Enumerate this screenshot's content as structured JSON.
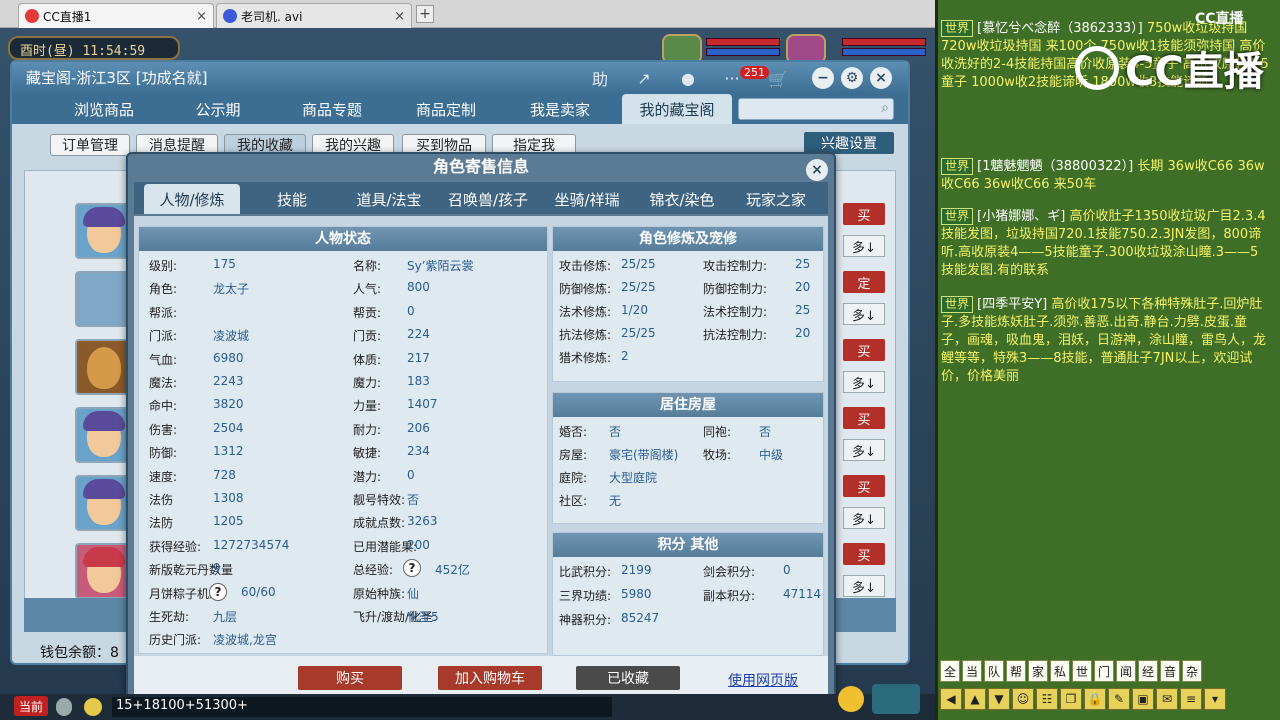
{
  "browser": {
    "tabs": [
      {
        "label": "CC直播1",
        "active": true
      },
      {
        "label": "老司机. avi",
        "active": false
      }
    ],
    "new_tab": "+",
    "close_glyph": "×"
  },
  "game": {
    "clock": "酉时(昼) 11:54:59",
    "bottom": {
      "current_tab": "当前",
      "input_text": "15+18100+51300+"
    }
  },
  "window": {
    "title": "藏宝阁-浙江3区 [功成名就]",
    "cart_badge": "251",
    "tool_labels": {
      "help": "助",
      "share": "↗",
      "record": "●",
      "chat": "···",
      "cart": "🛒",
      "min": "−",
      "settings": "⚙",
      "close": "×"
    },
    "nav": [
      "浏览商品",
      "公示期",
      "商品专题",
      "商品定制",
      "我是卖家",
      "我的藏宝阁"
    ],
    "nav_active": 5,
    "subtabs": [
      "订单管理",
      "消息提醒",
      "我的收藏",
      "我的兴趣",
      "买到物品",
      "指定我"
    ],
    "subtab_active": 2,
    "interest_button": "兴趣设置",
    "list_buttons": {
      "buy": "买",
      "more": "多↓",
      "fixed": "定"
    },
    "wallet_label": "钱包余额：8"
  },
  "modal": {
    "title": "角色寄售信息",
    "close": "×",
    "tabs": [
      "人物/修炼",
      "技能",
      "道具/法宝",
      "召唤兽/孩子",
      "坐骑/祥瑞",
      "锦衣/染色",
      "玩家之家"
    ],
    "tab_active": 0,
    "status": {
      "title": "人物状态",
      "left": [
        {
          "k": "级别:",
          "v": "175"
        },
        {
          "k": "角色:",
          "v": "龙太子"
        },
        {
          "k": "帮派:",
          "v": ""
        },
        {
          "k": "门派:",
          "v": "凌波城"
        },
        {
          "k": "气血:",
          "v": "6980"
        },
        {
          "k": "魔法:",
          "v": "2243"
        },
        {
          "k": "命中:",
          "v": "3820"
        },
        {
          "k": "伤害:",
          "v": "2504"
        },
        {
          "k": "防御:",
          "v": "1312"
        },
        {
          "k": "速度:",
          "v": "728"
        },
        {
          "k": "法伤",
          "v": "1308"
        },
        {
          "k": "法防",
          "v": "1205"
        },
        {
          "k": "获得经验:",
          "v": "1272734574"
        },
        {
          "k": "新版乾元丹数量",
          "v": "9"
        },
        {
          "k": "月饼粽子机缘:",
          "v": "60/60",
          "help": true
        },
        {
          "k": "生死劫:",
          "v": "九层"
        },
        {
          "k": "历史门派:",
          "v": "凌波城,龙宫"
        }
      ],
      "right": [
        {
          "k": "名称:",
          "v": "Sy’紫陌云裳"
        },
        {
          "k": "人气:",
          "v": "800"
        },
        {
          "k": "帮贡:",
          "v": "0"
        },
        {
          "k": "门贡:",
          "v": "224"
        },
        {
          "k": "体质:",
          "v": "217"
        },
        {
          "k": "魔力:",
          "v": "183"
        },
        {
          "k": "力量:",
          "v": "1407"
        },
        {
          "k": "耐力:",
          "v": "206"
        },
        {
          "k": "敏捷:",
          "v": "234"
        },
        {
          "k": "潜力:",
          "v": "0"
        },
        {
          "k": "靓号特效:",
          "v": "否"
        },
        {
          "k": "成就点数:",
          "v": "3263"
        },
        {
          "k": "已用潜能果:",
          "v": "200"
        },
        {
          "k": "总经验:",
          "v": "452亿",
          "help": true
        },
        {
          "k": "原始种族:",
          "v": "仙"
        },
        {
          "k": "飞升/渡劫/化圣:",
          "v": "化圣5"
        }
      ]
    },
    "cultivation": {
      "title": "角色修炼及宠修",
      "left": [
        {
          "k": "攻击修炼:",
          "v": "25/25"
        },
        {
          "k": "防御修炼:",
          "v": "25/25"
        },
        {
          "k": "法术修炼:",
          "v": "1/20"
        },
        {
          "k": "抗法修炼:",
          "v": "25/25"
        },
        {
          "k": "猎术修炼:",
          "v": "2"
        }
      ],
      "right": [
        {
          "k": "攻击控制力:",
          "v": "25"
        },
        {
          "k": "防御控制力:",
          "v": "20"
        },
        {
          "k": "法术控制力:",
          "v": "25"
        },
        {
          "k": "抗法控制力:",
          "v": "20"
        }
      ]
    },
    "house": {
      "title": "居住房屋",
      "left": [
        {
          "k": "婚否:",
          "v": "否"
        },
        {
          "k": "房屋:",
          "v": "豪宅(带阁楼)"
        },
        {
          "k": "庭院:",
          "v": "大型庭院"
        },
        {
          "k": "社区:",
          "v": "无"
        }
      ],
      "right": [
        {
          "k": "同袍:",
          "v": "否"
        },
        {
          "k": "牧场:",
          "v": "中级"
        }
      ]
    },
    "points": {
      "title": "积分 其他",
      "left": [
        {
          "k": "比武积分:",
          "v": "2199"
        },
        {
          "k": "三界功绩:",
          "v": "5980"
        },
        {
          "k": "神器积分:",
          "v": "85247"
        }
      ],
      "right": [
        {
          "k": "剑会积分:",
          "v": "0"
        },
        {
          "k": "副本积分:",
          "v": "47114"
        }
      ]
    },
    "footer": {
      "buy": "购买",
      "add_cart": "加入购物车",
      "collected": "已收藏",
      "web": "使用网页版"
    }
  },
  "chat": {
    "watermark": "CC直播",
    "watermark_small": "CC直播",
    "channel_label": "世界",
    "messages": [
      {
        "sender": "[慕忆兮べ念醉（3862333）]",
        "text": "750w收垃圾持国 720w收垃圾持国 来100个 750w收1技能须弥持国 高价收洗好的2-4技能持国高价收原装4-5童子 高价收原装4-5童子 1000w收2技能谛听 1800w收3技能谛听"
      },
      {
        "sender": "[1魑魅魍魉（38800322）]",
        "text": "长期 36w收C66 36w收C66 36w收C66 来50车"
      },
      {
        "sender": "[小猪娜娜、ギ]",
        "text": "高价收肚子1350收垃圾广目2.3.4技能发图，垃圾持国720.1技能750.2.3JN发图，800谛听.高收原装4——5技能童子.300收垃圾涂山瞳.3——5技能发图.有的联系"
      },
      {
        "sender": "[四季平安Y]",
        "text": "高价收175以下各种特殊肚子.回炉肚子.多技能炼妖肚子.须弥.善恶.出奇.静台.力劈.皮蛋.童子，画魂，吸血鬼，泪妖，日游神，涂山瞳，雷鸟人，龙鲤等等，特殊3——8技能，普通肚子7JN以上，欢迎试价，价格美丽"
      }
    ],
    "channels": [
      "全",
      "当",
      "队",
      "帮",
      "家",
      "私",
      "世",
      "门",
      "闻",
      "经",
      "音",
      "杂"
    ]
  }
}
